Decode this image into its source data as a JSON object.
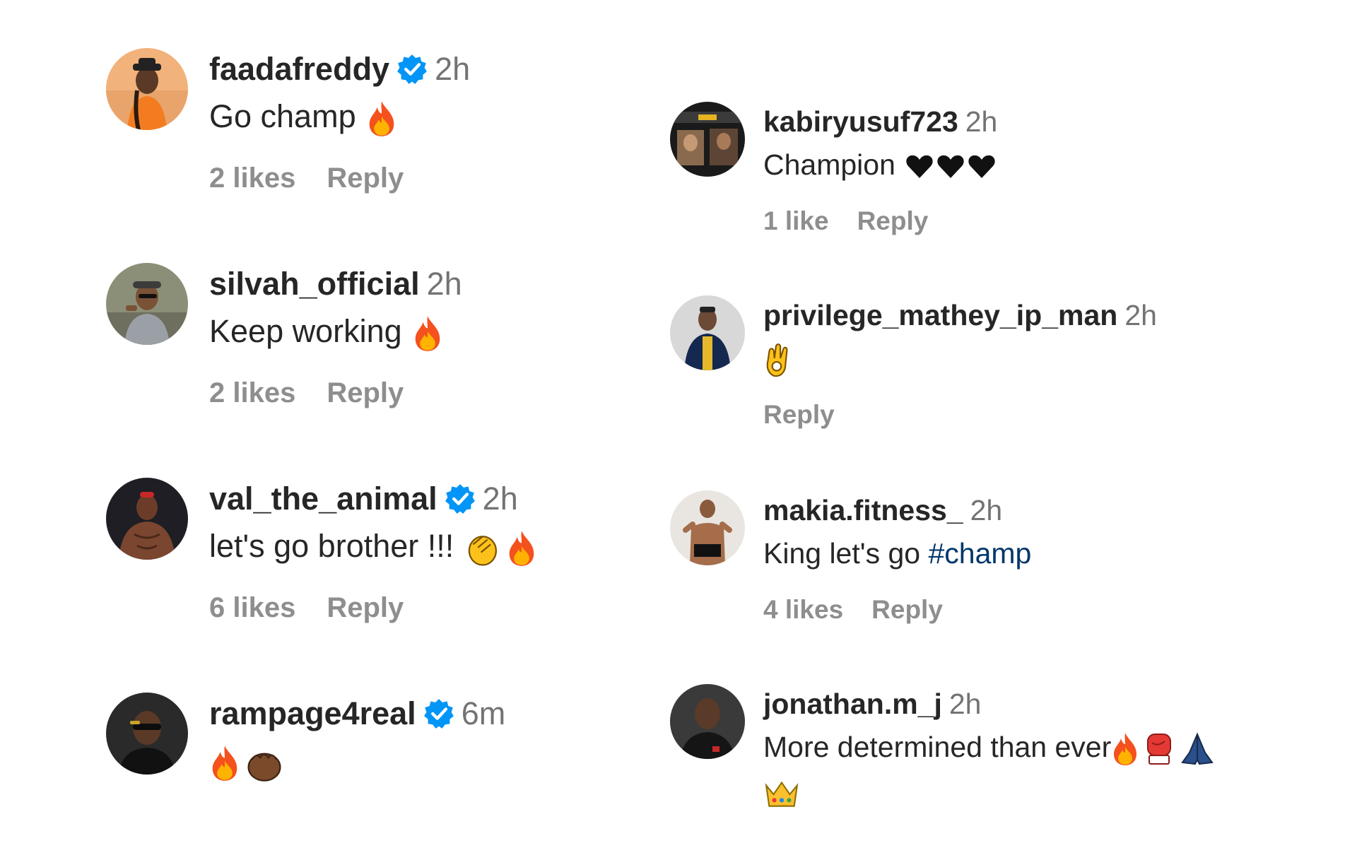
{
  "colors": {
    "text": "#262626",
    "secondary": "#737373",
    "action": "#8e8e8e",
    "verified": "#0095f6",
    "hashtag": "#00376b"
  },
  "comments_left": [
    {
      "username": "faadafreddy",
      "verified": true,
      "time": "2h",
      "text": "Go champ",
      "emojis": [
        "fire-emoji"
      ],
      "likes": "2 likes",
      "reply": "Reply",
      "avatar_icon": "avatar-person-orange"
    },
    {
      "username": "silvah_official",
      "verified": false,
      "time": "2h",
      "text": "Keep working",
      "emojis": [
        "fire-emoji"
      ],
      "likes": "2 likes",
      "reply": "Reply",
      "avatar_icon": "avatar-person-cap"
    },
    {
      "username": "val_the_animal",
      "verified": true,
      "time": "2h",
      "text": "let's go brother !!!",
      "emojis": [
        "clapping-hands-emoji",
        "fire-emoji"
      ],
      "likes": "6 likes",
      "reply": "Reply",
      "avatar_icon": "avatar-person-shirtless"
    },
    {
      "username": "rampage4real",
      "verified": true,
      "time": "6m",
      "text": "",
      "emojis": [
        "fire-emoji",
        "raised-fist-emoji"
      ],
      "likes": "",
      "reply": "",
      "avatar_icon": "avatar-person-sunglasses"
    }
  ],
  "comments_right": [
    {
      "username": "kabiryusuf723",
      "verified": false,
      "time": "2h",
      "text": "Champion",
      "emojis": [
        "black-heart-emoji",
        "black-heart-emoji",
        "black-heart-emoji"
      ],
      "likes": "1 like",
      "reply": "Reply",
      "avatar_icon": "avatar-collage"
    },
    {
      "username": "privilege_mathey_ip_man",
      "verified": false,
      "time": "2h",
      "text": "",
      "emojis": [
        "ok-hand-emoji"
      ],
      "likes": "",
      "reply": "Reply",
      "avatar_icon": "avatar-person-jacket"
    },
    {
      "username": "makia.fitness_",
      "verified": false,
      "time": "2h",
      "text": "King let's go",
      "hashtag": "#champ",
      "emojis": [],
      "likes": "4 likes",
      "reply": "Reply",
      "avatar_icon": "avatar-person-fitness"
    },
    {
      "username": "jonathan.m_j",
      "verified": false,
      "time": "2h",
      "text": "More determined than ever",
      "emojis": [
        "fire-emoji",
        "boxing-glove-emoji",
        "folded-hands-emoji"
      ],
      "emojis_line2": [
        "crown-emoji"
      ],
      "likes": "",
      "reply": "",
      "avatar_icon": "avatar-person-dark"
    }
  ]
}
